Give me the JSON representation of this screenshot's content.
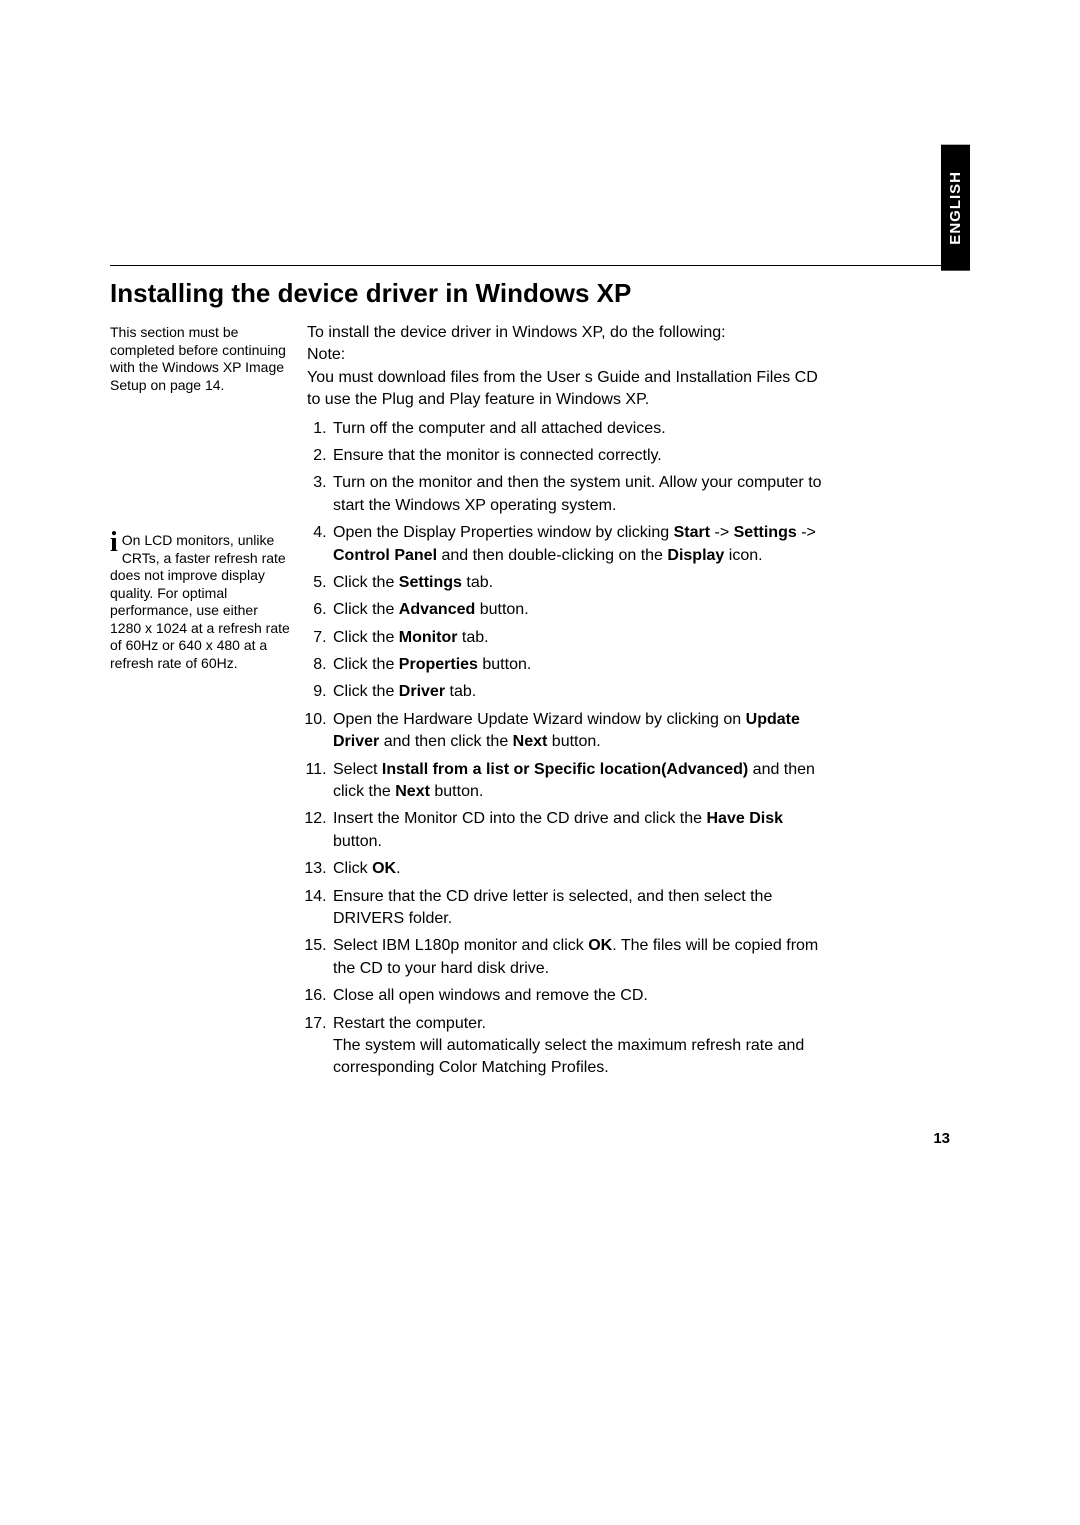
{
  "language_tab": "ENGLISH",
  "heading": "Installing the device driver in Windows XP",
  "sidenote1": "This section must be completed before continuing with the Windows XP Image Setup on page 14.",
  "sidenote2_text": "On LCD monitors, unlike CRTs, a faster refresh rate does not improve display quality. For optimal performance, use either 1280 x 1024 at a refresh rate of 60Hz or 640 x 480 at a refresh rate of 60Hz.",
  "intro_line1": "To install the device driver in Windows XP, do the following:",
  "intro_line2": "Note:",
  "intro_line3": "You must download files from the User s Guide and Installation Files CD to use the Plug and Play feature in Windows XP.",
  "steps": {
    "s1": "Turn off the computer and all attached devices.",
    "s2": "Ensure that the monitor is connected correctly.",
    "s3": "Turn on the monitor and then the system unit. Allow your computer to start the Windows XP operating system.",
    "s4_a": "Open the Display Properties window by clicking ",
    "s4_start": "Start",
    "s4_b": " -> ",
    "s4_settings": "Settings",
    "s4_c": " -> ",
    "s4_cp": "Control Panel",
    "s4_d": " and then double-clicking on the ",
    "s4_display": "Display",
    "s4_e": " icon.",
    "s5_a": "Click the ",
    "s5_b": "Settings",
    "s5_c": " tab.",
    "s6_a": "Click the ",
    "s6_b": "Advanced",
    "s6_c": " button.",
    "s7_a": "Click the ",
    "s7_b": "Monitor",
    "s7_c": " tab.",
    "s8_a": "Click the ",
    "s8_b": "Properties",
    "s8_c": " button.",
    "s9_a": "Click the ",
    "s9_b": "Driver",
    "s9_c": " tab.",
    "s10_a": "Open the Hardware Update Wizard window by clicking on ",
    "s10_b": "Update Driver",
    "s10_c": " and then click the ",
    "s10_d": "Next",
    "s10_e": " button.",
    "s11_a": "Select ",
    "s11_b": "Install from a list or Specific location(Advanced)",
    "s11_c": " and then click the ",
    "s11_d": "Next",
    "s11_e": " button.",
    "s12_a": "Insert the Monitor CD into the CD drive and click the ",
    "s12_b": "Have Disk",
    "s12_c": " button.",
    "s13_a": "Click ",
    "s13_b": "OK",
    "s13_c": ".",
    "s14": "Ensure that the CD drive letter is selected, and then select the DRIVERS folder.",
    "s15_a": "Select IBM L180p monitor and click ",
    "s15_b": "OK",
    "s15_c": ". The files will be copied from the CD to your hard disk drive.",
    "s16": "Close all open windows and remove the CD.",
    "s17_a": "Restart the computer.",
    "s17_b": "The system will automatically select the maximum refresh rate and corresponding Color Matching Profiles."
  },
  "page_number": "13"
}
